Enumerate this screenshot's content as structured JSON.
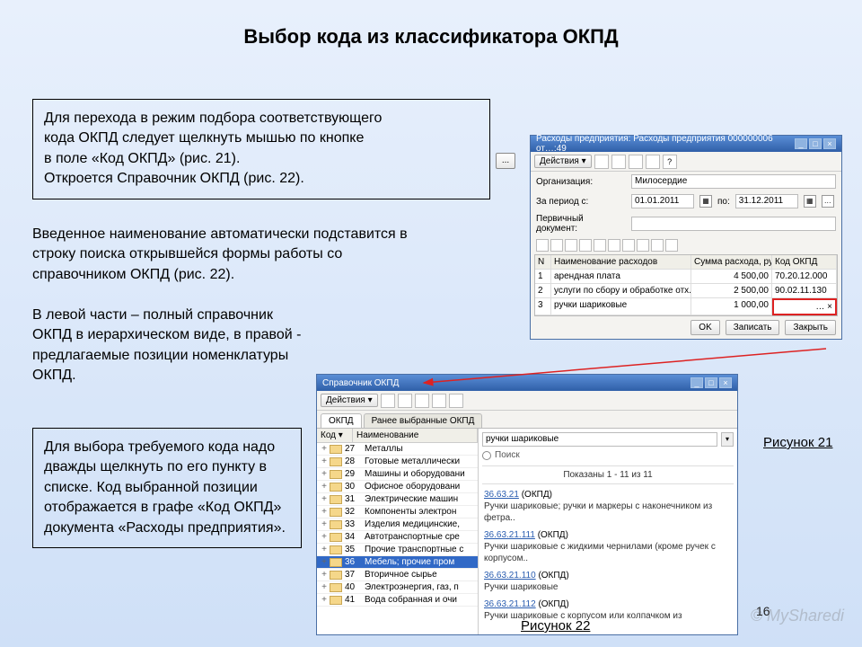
{
  "title": "Выбор кода из классификатора ОКПД",
  "box1_line1": "Для перехода в режим подбора соответствующего",
  "box1_line2": "кода ОКПД следует щелкнуть мышью по кнопке",
  "box1_line3": "в поле «Код ОКПД» (рис. 21).",
  "box1_line4": "Откроется Справочник ОКПД (рис. 22).",
  "para2": "Введенное наименование автоматически подставится в строку поиска открывшейся формы работы со справочником ОКПД (рис. 22).",
  "para3": "В левой части – полный справочник ОКПД в иерархическом виде, в правой - предлагаемые позиции номенклатуры ОКПД.",
  "box4": "Для выбора требуемого кода надо дважды щелкнуть по его пункту в списке. Код выбранной позиции отображается в графе «Код ОКПД» документа «Расходы предприятия».",
  "ellipsis": "...",
  "win1": {
    "title": "Расходы предприятия: Расходы предприятия 000000006 от…:49",
    "actions": "Действия ▾",
    "org_label": "Организация:",
    "org_value": "Милосердие",
    "period_label": "За период с:",
    "date_from": "01.01.2011",
    "period_to": "по:",
    "date_to": "31.12.2011",
    "doc_label": "Первичный документ:",
    "doc_value": "",
    "cols": {
      "n": "N",
      "name": "Наименование расходов",
      "sum": "Сумма расхода, рублей",
      "code": "Код ОКПД"
    },
    "rows": [
      {
        "n": "1",
        "name": "арендная плата",
        "sum": "4 500,00",
        "code": "70.20.12.000"
      },
      {
        "n": "2",
        "name": "услуги по сбору и обработке отх..",
        "sum": "2 500,00",
        "code": "90.02.11.130"
      },
      {
        "n": "3",
        "name": "ручки шариковые",
        "sum": "1 000,00",
        "code": ""
      }
    ],
    "btn_ok": "OK",
    "btn_save": "Записать",
    "btn_close": "Закрыть"
  },
  "win2": {
    "title": "Справочник ОКПД",
    "actions": "Действия ▾",
    "tab1": "ОКПД",
    "tab2": "Ранее выбранные ОКПД",
    "col_code": "Код",
    "col_name": "Наименование",
    "search_value": "ручки шариковые",
    "search_link": "Поиск",
    "results_header": "Показаны 1 - 11 из 11",
    "tree": [
      {
        "code": "27",
        "name": "Металлы"
      },
      {
        "code": "28",
        "name": "Готовые металлически"
      },
      {
        "code": "29",
        "name": "Машины и оборудовани"
      },
      {
        "code": "30",
        "name": "Офисное оборудовани"
      },
      {
        "code": "31",
        "name": "Электрические машин"
      },
      {
        "code": "32",
        "name": "Компоненты электрон"
      },
      {
        "code": "33",
        "name": "Изделия медицинские,"
      },
      {
        "code": "34",
        "name": "Автотранспортные сре"
      },
      {
        "code": "35",
        "name": "Прочие транспортные с"
      },
      {
        "code": "36",
        "name": "Мебель; прочие пром",
        "selected": true
      },
      {
        "code": "37",
        "name": "Вторичное сырье"
      },
      {
        "code": "40",
        "name": "Электроэнергия, газ, п"
      },
      {
        "code": "41",
        "name": "Вода собранная и очи"
      }
    ],
    "results": [
      {
        "code": "36.63.21",
        "tag": "(ОКПД)",
        "desc": "Ручки шариковые; ручки и маркеры с наконечником из фетра.."
      },
      {
        "code": "36.63.21.111",
        "tag": "(ОКПД)",
        "desc": "Ручки шариковые с жидкими чернилами (кроме ручек с корпусом.."
      },
      {
        "code": "36.63.21.110",
        "tag": "(ОКПД)",
        "desc": "Ручки шариковые"
      },
      {
        "code": "36.63.21.112",
        "tag": "(ОКПД)",
        "desc": "Ручки шариковые с корпусом или колпачком из"
      }
    ]
  },
  "fig21": "Рисунок 21",
  "fig22": "Рисунок 22",
  "page": "16",
  "watermark": "© MySharedi"
}
